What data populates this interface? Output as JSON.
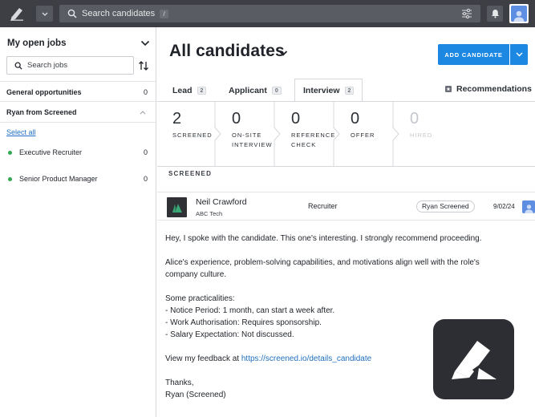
{
  "topbar": {
    "search_placeholder": "Search candidates",
    "search_shortcut": "/"
  },
  "sidebar": {
    "title": "My open jobs",
    "search_placeholder": "Search jobs",
    "groups": [
      {
        "label": "General opportunities",
        "count": "0"
      },
      {
        "label": "Ryan from Screened"
      }
    ],
    "select_all": "Select all",
    "jobs": [
      {
        "label": "Executive Recruiter",
        "count": "0"
      },
      {
        "label": "Senior Product Manager",
        "count": "0"
      }
    ]
  },
  "main": {
    "title": "All candidates",
    "add_button": "ADD CANDIDATE",
    "tabs": [
      {
        "label": "Lead",
        "count": "2"
      },
      {
        "label": "Applicant",
        "count": "0"
      },
      {
        "label": "Interview",
        "count": "2"
      }
    ],
    "recommendations": "Recommendations",
    "stages": [
      {
        "num": "2",
        "label": "SCREENED"
      },
      {
        "num": "0",
        "label": "ON-SITE INTERVIEW"
      },
      {
        "num": "0",
        "label": "REFERENCE CHECK"
      },
      {
        "num": "0",
        "label": "OFFER"
      },
      {
        "num": "0",
        "label": "HIRED"
      }
    ],
    "section_label": "SCREENED",
    "candidate": {
      "name": "Neil Crawford",
      "company": "ABC Tech",
      "role": "Recruiter",
      "tag": "Ryan Screened",
      "date": "9/02/24"
    },
    "note": {
      "p1": "Hey, I spoke with the candidate. This one's interesting. I strongly recommend proceeding.",
      "p2a": "Alice's experience, problem-solving capabilities, and motivations align well with the role's",
      "p2b": "company culture.",
      "p3a": "Some practicalities:",
      "p3b": "- Notice Period: 1 month, can start a week after.",
      "p3c": "- Work Authorisation: Requires sponsorship.",
      "p3d": "- Salary Expectation: Not discussed.",
      "p4_prefix": "View my feedback at ",
      "p4_link": "https://screened.io/details_candidate",
      "p5a": "Thanks,",
      "p5b": "Ryan (Screened)"
    }
  },
  "colors": {
    "topbar": "#3d3f44",
    "accent": "#1c88e2",
    "link": "#1f6fbf",
    "status_dot": "#2fa84f",
    "badge_bg": "#2c2e33"
  },
  "icons": {
    "logo": "pen-logo-icon",
    "search": "search-icon",
    "filter": "sliders-icon",
    "bell": "bell-icon",
    "avatar": "user-avatar-icon"
  }
}
